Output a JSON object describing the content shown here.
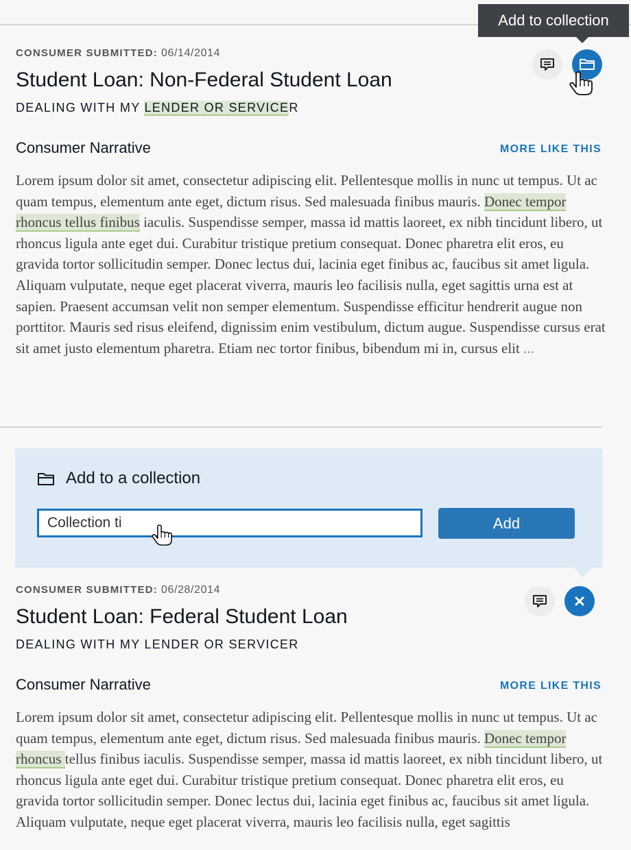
{
  "tooltip": {
    "text": "Add to collection"
  },
  "complaints": [
    {
      "submitted_label": "CONSUMER SUBMITTED:",
      "submitted_date": "06/14/2014",
      "title": "Student Loan: Non-Federal Student Loan",
      "subtitle_prefix": "DEALING WITH MY ",
      "subtitle_highlight": "LENDER OR SERVICE",
      "subtitle_suffix": "R",
      "narrative_heading": "Consumer Narrative",
      "more_like_this": "MORE LIKE THIS",
      "narrative_before": "Lorem ipsum dolor sit amet, consectetur adipiscing elit. Pellentesque mollis in nunc ut tempus. Ut ac quam tempus, elementum ante eget, dictum risus. Sed malesuada finibus mauris. ",
      "narrative_highlight": "Donec tempor rhoncus tellus finibus",
      "narrative_after": " iaculis. Suspendisse semper, massa id mattis laoreet, ex nibh tincidunt libero, ut rhoncus ligula ante eget dui. Curabitur tristique pretium consequat. Donec pharetra elit eros, eu gravida tortor sollicitudin semper. Donec lectus dui, lacinia eget finibus ac, faucibus sit amet ligula. Aliquam vulputate, neque eget placerat viverra, mauris leo facilisis nulla, eget sagittis urna est at sapien. Praesent accumsan velit non semper elementum. Suspendisse efficitur hendrerit augue non porttitor. Mauris sed risus eleifend, dignissim enim vestibulum, dictum augue. Suspendisse cursus erat sit amet justo elementum pharetra. Etiam nec tortor finibus, bibendum mi in, cursus elit ",
      "narrative_ellipsis": "...",
      "actions": [
        {
          "icon": "comment-icon",
          "state": "default"
        },
        {
          "icon": "folder-icon",
          "state": "active"
        }
      ]
    },
    {
      "submitted_label": "CONSUMER SUBMITTED:",
      "submitted_date": "06/28/2014",
      "title": "Student Loan: Federal Student Loan",
      "subtitle": "DEALING WITH MY LENDER OR SERVICER",
      "narrative_heading": "Consumer Narrative",
      "more_like_this": "MORE LIKE THIS",
      "narrative_before": "Lorem ipsum dolor sit amet, consectetur adipiscing elit. Pellentesque mollis in nunc ut tempus. Ut ac quam tempus, elementum ante eget, dictum risus. Sed malesuada finibus mauris. ",
      "narrative_highlight": "Donec tempor rhoncus ",
      "narrative_after": "tellus finibus iaculis. Suspendisse semper, massa id mattis laoreet, ex nibh tincidunt libero, ut rhoncus ligula ante eget dui. Curabitur tristique pretium consequat. Donec pharetra elit eros, eu gravida tortor sollicitudin semper. Donec lectus dui, lacinia eget finibus ac, faucibus sit amet ligula. Aliquam vulputate, neque eget placerat viverra, mauris leo facilisis nulla, eget sagittis",
      "actions": [
        {
          "icon": "comment-icon",
          "state": "default"
        },
        {
          "icon": "close-icon",
          "state": "active"
        }
      ]
    }
  ],
  "collection_panel": {
    "title": "Add to a collection",
    "icon": "folder-icon",
    "input_value": "Collection ti",
    "add_label": "Add"
  },
  "colors": {
    "accent": "#1a74bd",
    "highlight": "#dde8d4",
    "panel": "#deebf6",
    "tooltip": "#3e4247"
  }
}
